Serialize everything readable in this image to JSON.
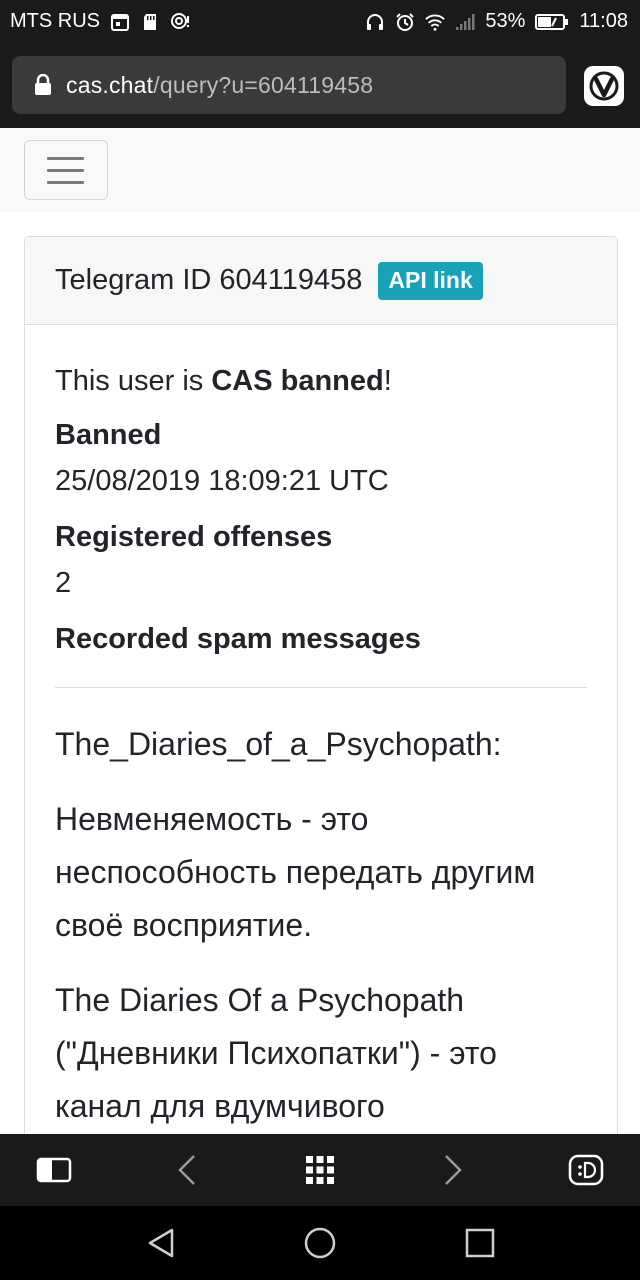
{
  "status_bar": {
    "carrier": "MTS RUS",
    "battery": "53%",
    "time": "11:08"
  },
  "address_bar": {
    "domain": "cas.chat",
    "path": "/query?u=604119458"
  },
  "card": {
    "title": "Telegram ID 604119458",
    "badge": "API link",
    "status_prefix": "This user is ",
    "status_bold": "CAS banned",
    "status_suffix": "!",
    "fields": [
      {
        "label": "Banned",
        "value": "25/08/2019 18:09:21 UTC"
      },
      {
        "label": "Registered offenses",
        "value": "2"
      }
    ],
    "messages_label": "Recorded spam messages",
    "messages": [
      "The_Diaries_of_a_Psychopath:",
      "Невменяемость - это неспособность передать другим своё восприятие.",
      "The Diaries Of a Psychopath (\"Дневники Психопатки\") - это канал для вдумчивого"
    ]
  },
  "colors": {
    "badge": "#17a2b8",
    "chrome": "#1a1a1a"
  }
}
